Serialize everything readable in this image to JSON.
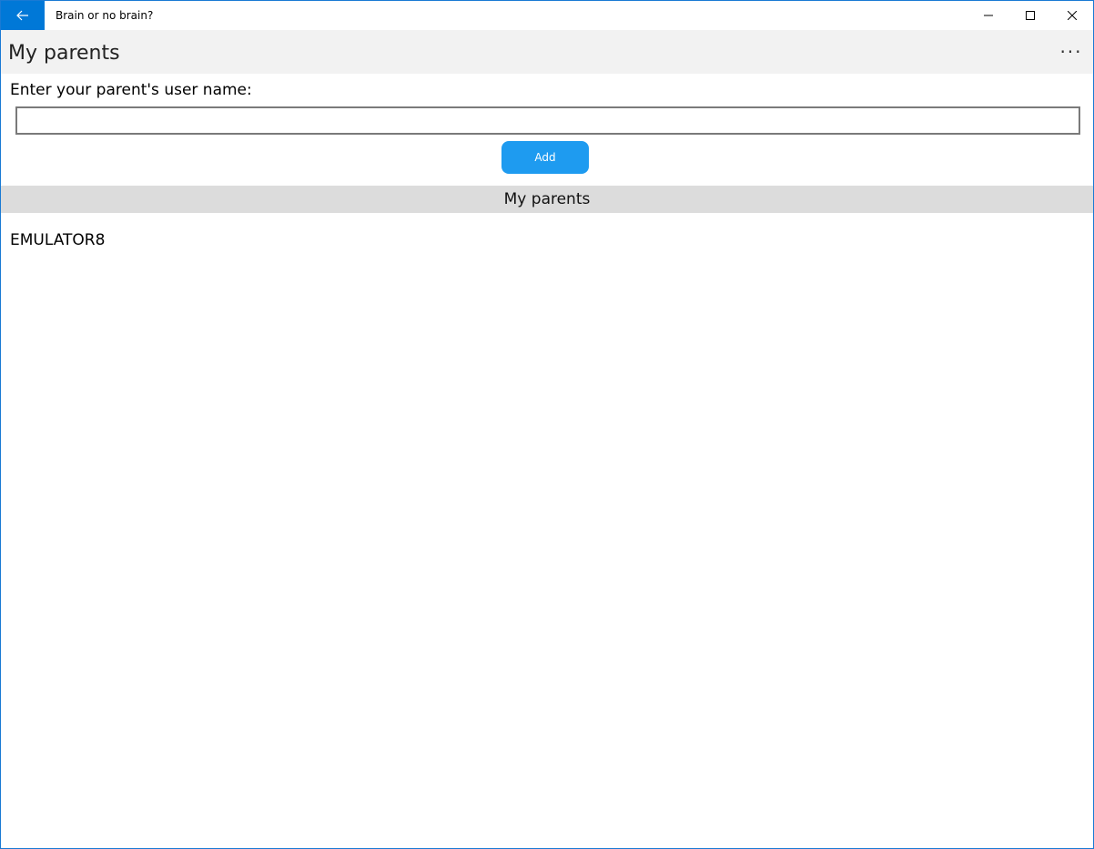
{
  "window": {
    "title": "Brain or no brain?",
    "accent_color": "#0078d7",
    "icons": {
      "back": "arrow-left-icon",
      "minimize": "minimize-icon",
      "maximize": "maximize-icon",
      "close": "close-icon"
    }
  },
  "header": {
    "title": "My parents",
    "more_label": "···"
  },
  "form": {
    "prompt": "Enter your parent's user name:",
    "input_value": "",
    "input_placeholder": "",
    "add_label": "Add",
    "add_color": "#1e9bf0"
  },
  "section": {
    "title": "My parents"
  },
  "parents": [
    {
      "name": "EMULATOR8"
    }
  ]
}
